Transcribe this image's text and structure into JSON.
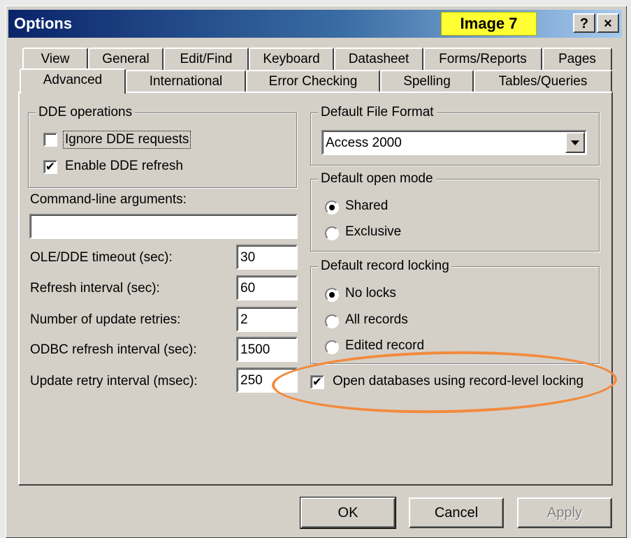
{
  "window": {
    "title": "Options",
    "badge": "Image 7",
    "help_button": "?",
    "close_button": "×"
  },
  "tabs": {
    "row1": [
      "View",
      "General",
      "Edit/Find",
      "Keyboard",
      "Datasheet",
      "Forms/Reports",
      "Pages"
    ],
    "row2": [
      "Advanced",
      "International",
      "Error Checking",
      "Spelling",
      "Tables/Queries"
    ],
    "active": "Advanced"
  },
  "dde": {
    "legend": "DDE operations",
    "ignore_label": "Ignore DDE requests",
    "ignore_checked": false,
    "enable_label": "Enable DDE refresh",
    "enable_checked": true
  },
  "command_line": {
    "label": "Command-line arguments:",
    "value": ""
  },
  "numeric_fields": [
    {
      "label": "OLE/DDE timeout (sec):",
      "value": "30"
    },
    {
      "label": "Refresh interval (sec):",
      "value": "60"
    },
    {
      "label": "Number of update retries:",
      "value": "2"
    },
    {
      "label": "ODBC refresh interval (sec):",
      "value": "1500"
    },
    {
      "label": "Update retry interval (msec):",
      "value": "250"
    }
  ],
  "file_format": {
    "legend": "Default File Format",
    "selected": "Access 2000"
  },
  "open_mode": {
    "legend": "Default open mode",
    "options": [
      "Shared",
      "Exclusive"
    ],
    "selected": "Shared"
  },
  "record_locking": {
    "legend": "Default record locking",
    "options": [
      "No locks",
      "All records",
      "Edited record"
    ],
    "selected": "No locks"
  },
  "record_level_locking": {
    "label": "Open databases using record-level locking",
    "checked": true
  },
  "buttons": {
    "ok": "OK",
    "cancel": "Cancel",
    "apply": "Apply"
  },
  "colors": {
    "highlight_ellipse": "#f28a3c",
    "badge": "#ffff33",
    "titlebar": "#0a246a"
  }
}
